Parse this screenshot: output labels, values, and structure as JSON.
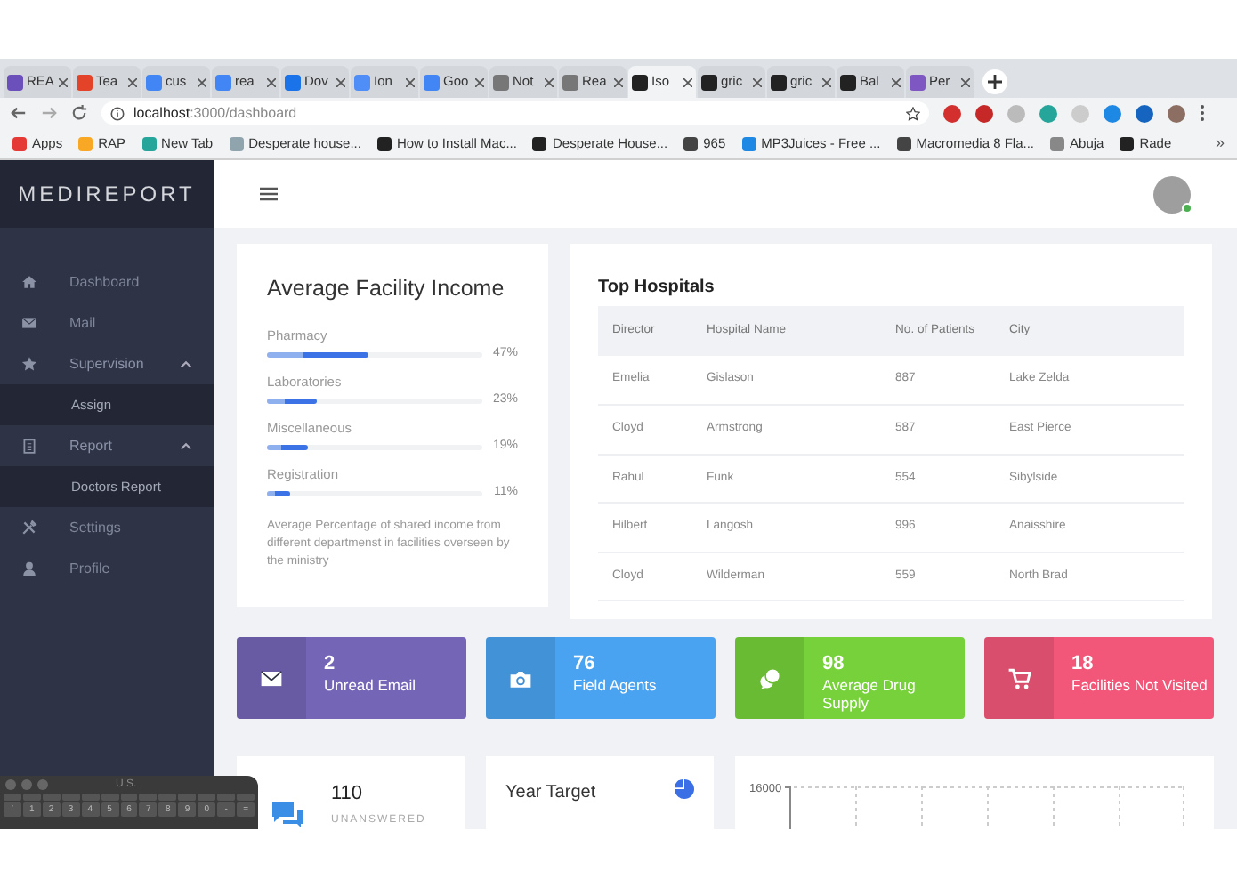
{
  "browser": {
    "tabs": [
      {
        "label": "REA",
        "selected": false,
        "color": "#6b4fbb"
      },
      {
        "label": "Tea",
        "selected": false,
        "color": "#e24329"
      },
      {
        "label": "cus",
        "selected": false,
        "color": "#4285f4"
      },
      {
        "label": "rea",
        "selected": false,
        "color": "#4285f4"
      },
      {
        "label": "Dov",
        "selected": false,
        "color": "#1a73e8"
      },
      {
        "label": "Ion",
        "selected": false,
        "color": "#4f8ef7"
      },
      {
        "label": "Goo",
        "selected": false,
        "color": "#4285f4"
      },
      {
        "label": "Not",
        "selected": false,
        "color": "#777777"
      },
      {
        "label": "Rea",
        "selected": false,
        "color": "#777777"
      },
      {
        "label": "Iso",
        "selected": true,
        "color": "#222222"
      },
      {
        "label": "gric",
        "selected": false,
        "color": "#222222"
      },
      {
        "label": "gric",
        "selected": false,
        "color": "#222222"
      },
      {
        "label": "Bal",
        "selected": false,
        "color": "#222222"
      },
      {
        "label": "Per",
        "selected": false,
        "color": "#7e57c2"
      }
    ],
    "address_host": "localhost",
    "address_path": ":3000/dashboard",
    "bookmarks": [
      "Apps",
      "RAP",
      "New Tab",
      "Desperate house...",
      "How to Install Mac...",
      "Desperate House...",
      "965",
      "MP3Juices - Free ...",
      "Macromedia 8 Fla...",
      "Abuja",
      "Rade"
    ],
    "bookmarks_more": "»"
  },
  "sidebar": {
    "brand": "MEDIREPORT",
    "items": [
      {
        "label": "Dashboard"
      },
      {
        "label": "Mail"
      },
      {
        "label": "Supervision",
        "expanded": true,
        "children": [
          {
            "label": "Assign"
          }
        ]
      },
      {
        "label": "Report",
        "expanded": true,
        "children": [
          {
            "label": "Doctors Report"
          }
        ]
      },
      {
        "label": "Settings"
      },
      {
        "label": "Profile"
      }
    ]
  },
  "income": {
    "title": "Average Facility Income",
    "items": [
      {
        "label": "Pharmacy",
        "level": 0.47,
        "reading": "47%"
      },
      {
        "label": "Laboratories",
        "level": 0.23,
        "reading": "23%"
      },
      {
        "label": "Miscellaneous",
        "level": 0.19,
        "reading": "19%"
      },
      {
        "label": "Registration",
        "level": 0.11,
        "reading": "11%"
      }
    ],
    "note": "Average Percentage of shared income from different departmenst in facilities overseen by the ministry"
  },
  "hospitals": {
    "title": "Top Hospitals",
    "columns": [
      "Director",
      "Hospital Name",
      "No. of Patients",
      "City"
    ],
    "rows": [
      [
        "Emelia",
        "Gislason",
        "887",
        "Lake Zelda"
      ],
      [
        "Cloyd",
        "Armstrong",
        "587",
        "East Pierce"
      ],
      [
        "Rahul",
        "Funk",
        "554",
        "Sibylside"
      ],
      [
        "Hilbert",
        "Langosh",
        "996",
        "Anaisshire"
      ],
      [
        "Cloyd",
        "Wilderman",
        "559",
        "North Brad"
      ]
    ]
  },
  "stats": [
    {
      "value": "2",
      "label": "Unread Email",
      "color": "#7565b7"
    },
    {
      "value": "76",
      "label": "Field Agents",
      "color": "#4aa3f0"
    },
    {
      "value": "98",
      "label": "Average Drug Supply",
      "color": "#77d13a"
    },
    {
      "value": "18",
      "label": "Facilities Not Visited",
      "color": "#f25779"
    }
  ],
  "messages": {
    "value": "110",
    "label": "UNANSWERED"
  },
  "year_target": {
    "title": "Year Target"
  },
  "chart": {
    "y_tick": "16000"
  },
  "keyboard_viewer": {
    "title": "U.S.",
    "keys": [
      "`",
      "1",
      "2",
      "3",
      "4",
      "5",
      "6",
      "7",
      "8",
      "9",
      "0",
      "-",
      "="
    ]
  }
}
